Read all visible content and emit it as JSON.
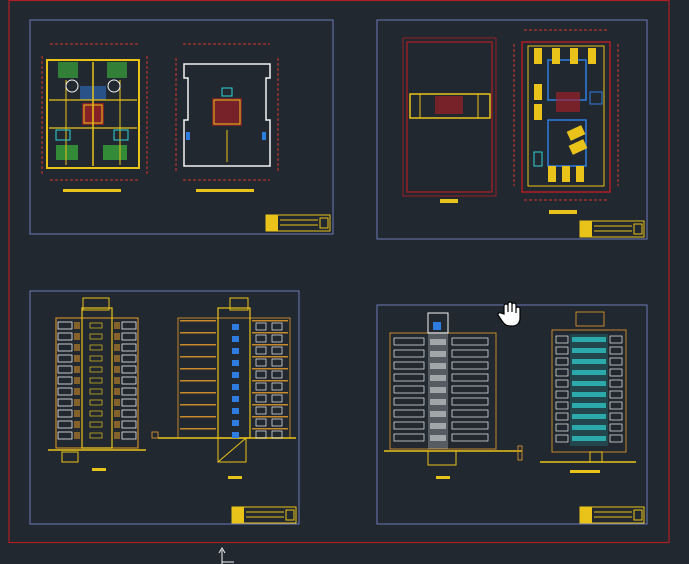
{
  "app": {
    "name": "",
    "view": "model-space"
  },
  "cursor": {
    "type": "pan-hand"
  },
  "colors": {
    "background": "#212830",
    "outer_frame": "#b01e24",
    "sheet_border": "#6d7ab8",
    "walls": "#e9c21a",
    "grid": "#d9362c",
    "cyan": "#2fd3d3",
    "blue": "#2f7ce0",
    "white": "#f2f2f2",
    "green": "#3aa43a",
    "orange": "#c8892a"
  },
  "sheets": [
    {
      "id": "floor-plans",
      "views": [
        "typical-floor-plan",
        "ground-floor-plan"
      ]
    },
    {
      "id": "site-and-parking",
      "views": [
        "site-plan",
        "parking-plan"
      ]
    },
    {
      "id": "front-and-section",
      "views": [
        "front-elevation",
        "section"
      ]
    },
    {
      "id": "side-and-rear",
      "views": [
        "side-elevation",
        "rear-elevation"
      ]
    }
  ]
}
